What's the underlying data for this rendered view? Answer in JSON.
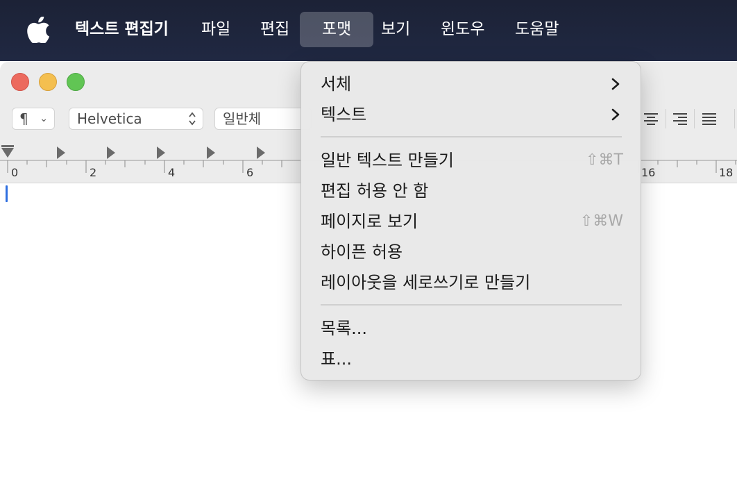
{
  "menubar": {
    "apple_icon": "apple-logo-icon",
    "app_name": "텍스트 편집기",
    "items": [
      "파일",
      "편집",
      "포맷",
      "보기",
      "윈도우",
      "도움말"
    ],
    "active": "포맷"
  },
  "toolbar": {
    "paragraph_symbol": "¶",
    "paragraph_chevron": "⌄",
    "font_family": "Helvetica",
    "font_updown": "⌃⌄",
    "font_style": "일반체",
    "alignment_icons": [
      "align-center-icon",
      "align-right-icon",
      "align-justify-icon"
    ]
  },
  "ruler": {
    "labels": [
      "0",
      "2",
      "4",
      "6",
      "16",
      "18"
    ]
  },
  "format_menu": {
    "items": [
      {
        "label": "서체",
        "submenu": true
      },
      {
        "label": "텍스트",
        "submenu": true
      },
      {
        "label": "일반 텍스트 만들기",
        "shortcut": "⇧⌘T"
      },
      {
        "label": "편집 허용 안 함"
      },
      {
        "label": "페이지로 보기",
        "shortcut": "⇧⌘W"
      },
      {
        "label": "하이픈 허용"
      },
      {
        "label": "레이아웃을 세로쓰기로 만들기"
      },
      {
        "label": "목록..."
      },
      {
        "label": "표..."
      }
    ]
  },
  "colors": {
    "menubar_bg": "#1c2236",
    "menu_bg": "#e8e8e8",
    "caret": "#2f6fe0"
  }
}
